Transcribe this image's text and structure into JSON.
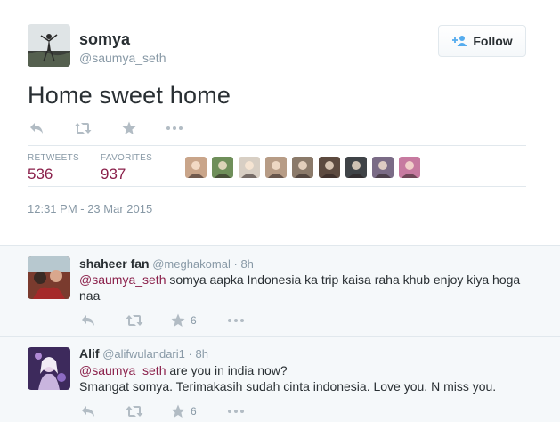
{
  "colors": {
    "accent": "#8a1f4a",
    "muted": "#8899a6",
    "text": "#292f33",
    "border": "#e1e8ed",
    "icon": "#b2bcc4"
  },
  "author": {
    "name": "somya",
    "handle": "@saumya_seth",
    "avatar_icon": "profile-photo"
  },
  "follow": {
    "label": "Follow",
    "icon": "add-user-icon"
  },
  "tweet": {
    "text": "Home sweet home",
    "timestamp": "12:31 PM - 23 Mar 2015"
  },
  "actions": {
    "reply_icon": "reply-icon",
    "retweet_icon": "retweet-icon",
    "favorite_icon": "star-icon",
    "more_icon": "more-icon"
  },
  "stats": {
    "retweets_label": "RETWEETS",
    "retweets_value": "536",
    "favorites_label": "FAVORITES",
    "favorites_value": "937"
  },
  "favoriters": [
    {
      "name": "favoriter-1",
      "color": "#c9a58a"
    },
    {
      "name": "favoriter-2",
      "color": "#6f8f5a"
    },
    {
      "name": "favoriter-3",
      "color": "#d8cfc4"
    },
    {
      "name": "favoriter-4",
      "color": "#b79c86"
    },
    {
      "name": "favoriter-5",
      "color": "#8b7a6a"
    },
    {
      "name": "favoriter-6",
      "color": "#5d4a3f"
    },
    {
      "name": "favoriter-7",
      "color": "#3f4347"
    },
    {
      "name": "favoriter-8",
      "color": "#7a6b86"
    },
    {
      "name": "favoriter-9",
      "color": "#c77aa0"
    }
  ],
  "replies": [
    {
      "name": "shaheer fan",
      "handle": "@meghakomal",
      "separator": "·",
      "time": "8h",
      "mention": "@saumya_seth",
      "text": " somya aapka Indonesia ka trip kaisa raha khub enjoy kiya hoga naa",
      "favorites": "6"
    },
    {
      "name": "Alif",
      "handle": "@alifwulandari1",
      "separator": "·",
      "time": "8h",
      "mention": "@saumya_seth",
      "text": " are you in india now?",
      "text2": "Smangat somya. Terimakasih sudah cinta indonesia. Love you. N miss you.",
      "favorites": "6"
    }
  ]
}
